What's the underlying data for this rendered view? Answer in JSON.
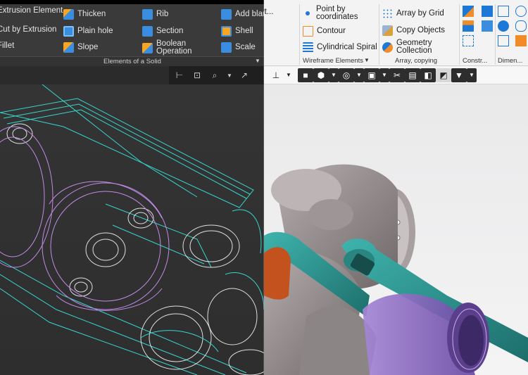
{
  "dark_ribbon": {
    "col1": [
      "Extrusion Element",
      "Cut by Extrusion",
      "Fillet"
    ],
    "col2": [
      "Thicken",
      "Plain hole",
      "Slope"
    ],
    "col3": [
      "Rib",
      "Section",
      "Boolean Operation"
    ],
    "col4": [
      "Add blank part...",
      "Shell",
      "Scale"
    ],
    "group_label": "Elements of a Solid"
  },
  "light_ribbon": {
    "wireframe": [
      "Point by coordinates",
      "Contour",
      "Cylindrical Spiral"
    ],
    "array": [
      "Array by Grid",
      "Copy Objects",
      "Geometry Collection"
    ],
    "groups": [
      "Wireframe Elements",
      "Array, copying",
      "Constr...",
      "Dimen..."
    ]
  },
  "colors": {
    "dark_bg": "#2b2b2b",
    "light_bg": "#f0f0f0",
    "wire_cyan": "#37d5cf",
    "wire_violet": "#c28be6",
    "solid_teal": "#2e8f8c",
    "solid_gray": "#8f8889",
    "solid_purple": "#8e68c2",
    "solid_orange": "#c4521e"
  },
  "icons": {
    "dark_toolbar": [
      "sketch-icon",
      "view-icon",
      "zoom-icon",
      "dropdown-icon",
      "coordinate-icon"
    ],
    "light_toolbar": [
      "axes-icon",
      "cube-icon",
      "shading-icon",
      "hide-icon",
      "camera-icon",
      "section-icon",
      "display-icon",
      "filter-icon"
    ]
  }
}
